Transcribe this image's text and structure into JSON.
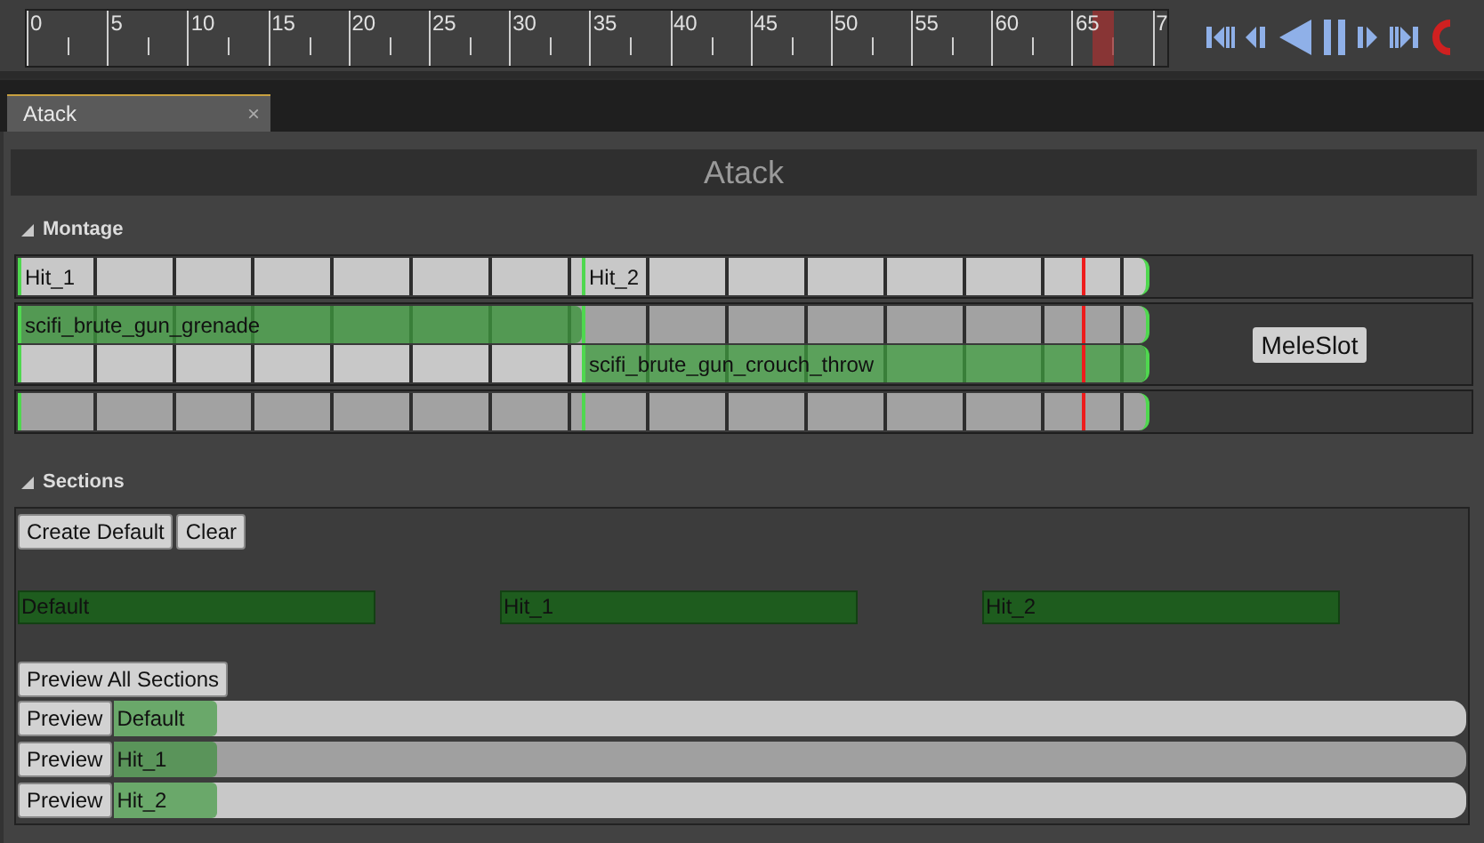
{
  "timeline": {
    "ticks": [
      "0",
      "5",
      "10",
      "15",
      "20",
      "25",
      "30",
      "35",
      "40",
      "45",
      "50",
      "55",
      "60",
      "65",
      "7"
    ],
    "playhead": {
      "level": 0.935
    }
  },
  "tabs": [
    {
      "label": "Atack",
      "selected": true,
      "close": "×"
    }
  ],
  "editor": {
    "title": "Atack"
  },
  "montage": {
    "header": "Montage",
    "expanded": true,
    "marker": {
      "level": 0.943
    },
    "tracks": [
      {
        "kind": "sections",
        "lanes": [
          {
            "kind": "light",
            "segments": [
              {
                "kind": "section",
                "label": "Hit_1"
              },
              {
                "kind": "section",
                "label": "Hit_2"
              }
            ]
          }
        ]
      },
      {
        "kind": "slot",
        "slot_label": "MeleSlot",
        "lanes": [
          {
            "kind": "dark",
            "segments": [
              {
                "kind": "clip",
                "label": "scifi_brute_gun_grenade"
              },
              {
                "kind": "empty"
              }
            ]
          },
          {
            "kind": "light",
            "segments": [
              {
                "kind": "empty"
              },
              {
                "kind": "clip",
                "label": "scifi_brute_gun_crouch_throw"
              }
            ]
          }
        ]
      },
      {
        "kind": "notifies",
        "lanes": [
          {
            "kind": "dark",
            "segments": [
              {
                "kind": "empty"
              },
              {
                "kind": "empty"
              }
            ]
          }
        ]
      }
    ]
  },
  "sections": {
    "header": "Sections",
    "expanded": true,
    "buttons": [
      "Create Default",
      "Clear"
    ],
    "items": [
      "Default",
      "Hit_1",
      "Hit_2"
    ],
    "preview_all": "Preview All Sections",
    "previews": [
      {
        "button": "Preview",
        "label": "Default",
        "selected": false
      },
      {
        "button": "Preview",
        "label": "Hit_1",
        "selected": true
      },
      {
        "button": "Preview",
        "label": "Hit_2",
        "selected": false
      }
    ]
  }
}
